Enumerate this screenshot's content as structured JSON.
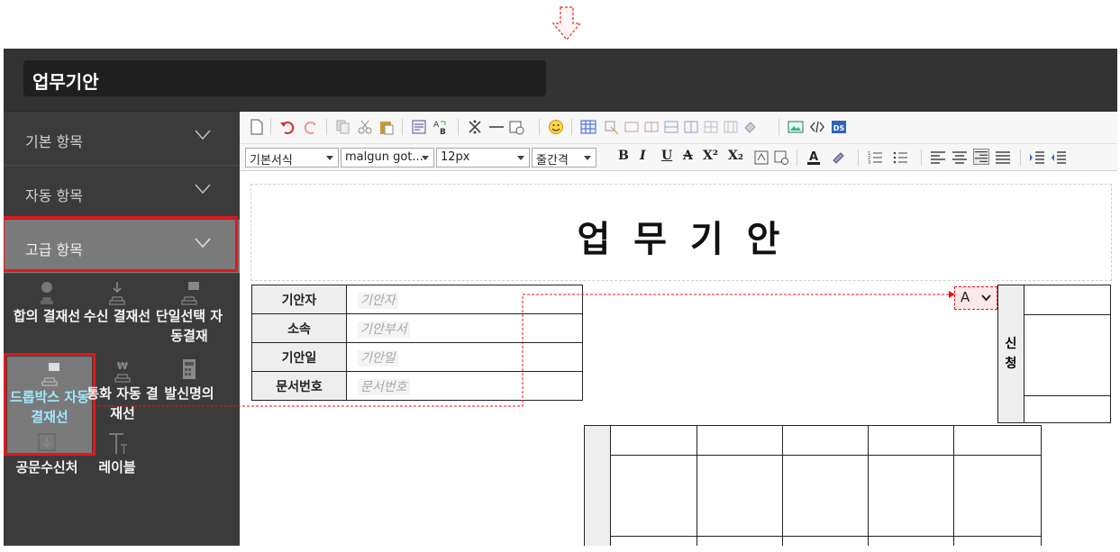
{
  "app": {
    "title": "업무기안"
  },
  "sidebar": {
    "sections": [
      {
        "label": "기본 항목"
      },
      {
        "label": "자동 항목"
      },
      {
        "label": "고급 항목"
      }
    ],
    "tiles": [
      {
        "label": "합의 결재선",
        "icon": "stamp-user-icon"
      },
      {
        "label": "수신 결재선",
        "icon": "stamp-down-icon"
      },
      {
        "label": "단일선택 자동결재",
        "icon": "stamp-card-icon"
      },
      {
        "label": "드롭박스 자동결재선",
        "icon": "stamp-card-icon"
      },
      {
        "label": "통화 자동 결재선",
        "icon": "stamp-won-icon"
      },
      {
        "label": "발신명의",
        "icon": "calculator-icon"
      },
      {
        "label": "공문수신처",
        "icon": "inbox-down-icon"
      },
      {
        "label": "레이블",
        "icon": "label-t-icon"
      }
    ]
  },
  "toolbar": {
    "format_select": "기본서식",
    "font_select": "malgun got...",
    "size_select": "12px",
    "spacing_select": "줄간격",
    "format_buttons": [
      "B",
      "I",
      "U",
      "A",
      "X²",
      "X₂"
    ]
  },
  "document": {
    "title": "업 무 기 안",
    "info_rows": [
      {
        "label": "기안자",
        "placeholder": "기안자"
      },
      {
        "label": "소속",
        "placeholder": "기안부서"
      },
      {
        "label": "기안일",
        "placeholder": "기안일"
      },
      {
        "label": "문서번호",
        "placeholder": "문서번호"
      }
    ],
    "sign_dropdown_value": "A",
    "sign_label": "신청"
  },
  "colors": {
    "highlight": "#e8141c",
    "selected_text": "#9fe8ff",
    "sidebar_bg": "#3b3b3b"
  }
}
